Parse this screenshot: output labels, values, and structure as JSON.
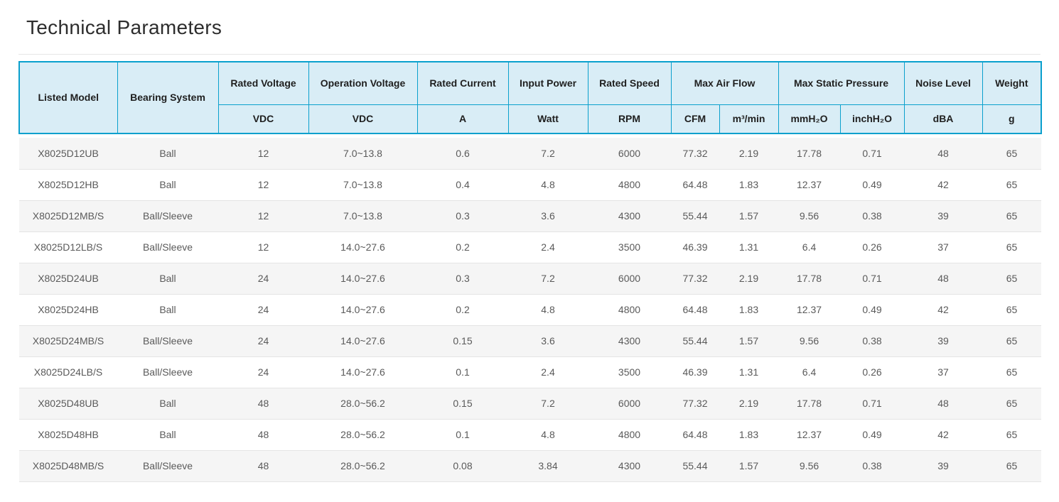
{
  "page": {
    "title": "Technical Parameters"
  },
  "table": {
    "header": {
      "listed_model": "Listed Model",
      "bearing_system": "Bearing System",
      "rated_voltage": "Rated Voltage",
      "operation_voltage": "Operation Voltage",
      "rated_current": "Rated Current",
      "input_power": "Input Power",
      "rated_speed": "Rated Speed",
      "max_air_flow": "Max Air Flow",
      "max_static_pressure": "Max Static Pressure",
      "noise_level": "Noise Level",
      "weight": "Weight",
      "units": {
        "rated_voltage": "VDC",
        "operation_voltage": "VDC",
        "rated_current": "A",
        "input_power": "Watt",
        "rated_speed": "RPM",
        "air_flow_cfm": "CFM",
        "air_flow_m3min": "m³/min",
        "pressure_mmh2o": "mmH₂O",
        "pressure_inchh2o": "inchH₂O",
        "noise_level": "dBA",
        "weight": "g"
      }
    },
    "colors": {
      "header_border": "#0aa0cd",
      "header_background": "#d9edf6",
      "stripe_background": "#f5f5f5",
      "row_divider": "#e4e4e4",
      "data_text": "#5a5a5a"
    },
    "rows": [
      [
        "X8025D12UB",
        "Ball",
        "12",
        "7.0~13.8",
        "0.6",
        "7.2",
        "6000",
        "77.32",
        "2.19",
        "17.78",
        "0.71",
        "48",
        "65"
      ],
      [
        "X8025D12HB",
        "Ball",
        "12",
        "7.0~13.8",
        "0.4",
        "4.8",
        "4800",
        "64.48",
        "1.83",
        "12.37",
        "0.49",
        "42",
        "65"
      ],
      [
        "X8025D12MB/S",
        "Ball/Sleeve",
        "12",
        "7.0~13.8",
        "0.3",
        "3.6",
        "4300",
        "55.44",
        "1.57",
        "9.56",
        "0.38",
        "39",
        "65"
      ],
      [
        "X8025D12LB/S",
        "Ball/Sleeve",
        "12",
        "14.0~27.6",
        "0.2",
        "2.4",
        "3500",
        "46.39",
        "1.31",
        "6.4",
        "0.26",
        "37",
        "65"
      ],
      [
        "X8025D24UB",
        "Ball",
        "24",
        "14.0~27.6",
        "0.3",
        "7.2",
        "6000",
        "77.32",
        "2.19",
        "17.78",
        "0.71",
        "48",
        "65"
      ],
      [
        "X8025D24HB",
        "Ball",
        "24",
        "14.0~27.6",
        "0.2",
        "4.8",
        "4800",
        "64.48",
        "1.83",
        "12.37",
        "0.49",
        "42",
        "65"
      ],
      [
        "X8025D24MB/S",
        "Ball/Sleeve",
        "24",
        "14.0~27.6",
        "0.15",
        "3.6",
        "4300",
        "55.44",
        "1.57",
        "9.56",
        "0.38",
        "39",
        "65"
      ],
      [
        "X8025D24LB/S",
        "Ball/Sleeve",
        "24",
        "14.0~27.6",
        "0.1",
        "2.4",
        "3500",
        "46.39",
        "1.31",
        "6.4",
        "0.26",
        "37",
        "65"
      ],
      [
        "X8025D48UB",
        "Ball",
        "48",
        "28.0~56.2",
        "0.15",
        "7.2",
        "6000",
        "77.32",
        "2.19",
        "17.78",
        "0.71",
        "48",
        "65"
      ],
      [
        "X8025D48HB",
        "Ball",
        "48",
        "28.0~56.2",
        "0.1",
        "4.8",
        "4800",
        "64.48",
        "1.83",
        "12.37",
        "0.49",
        "42",
        "65"
      ],
      [
        "X8025D48MB/S",
        "Ball/Sleeve",
        "48",
        "28.0~56.2",
        "0.08",
        "3.84",
        "4300",
        "55.44",
        "1.57",
        "9.56",
        "0.38",
        "39",
        "65"
      ]
    ]
  }
}
